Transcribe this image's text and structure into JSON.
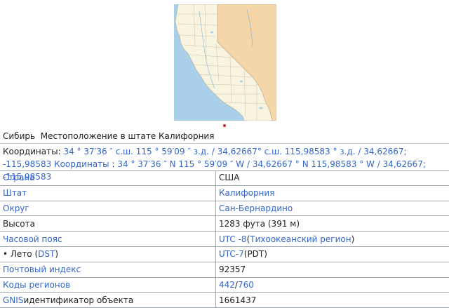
{
  "caption": {
    "name": "Сибирь",
    "text": "Местоположение в штате Калифорния"
  },
  "coordinates": {
    "label": "Координаты:",
    "dms": "34 ° 37′36 ″ с.ш. 115 ° 59′09 ″ з.д.",
    "sep1": " / ",
    "decimal": "34,62667° с.ш. 115,98583 ° з.д.",
    "sep2": " / ",
    "signed": "34,62667; -115,98583",
    "label2": "Координаты",
    "colon": " : ",
    "dms2": "34 ° 37′36 ″ N 115 ° 59′09 ″ W",
    "sep3": " / ",
    "decimal2": "34,62667 ° N 115,98583 ° W",
    "sep4": " / ",
    "signed2": "34,62667; -115,98583"
  },
  "rows": {
    "country": {
      "label": "Страна",
      "value": "США"
    },
    "state": {
      "label": "Штат",
      "value": "Калифорния"
    },
    "county": {
      "label": "Округ",
      "value": "Сан-Бернардино"
    },
    "elevation": {
      "label": "Высота",
      "value": "1283 фута (391 м)"
    },
    "timezone": {
      "label": "Часовой пояс",
      "utc": "UTC -8",
      "open": " (",
      "region": "Тихоокеанский регион",
      "close": " )"
    },
    "summer": {
      "bullet": "• Лето (",
      "dst": "DST",
      "close": " )",
      "utc": "UTC-7",
      "paren": " (PDT)"
    },
    "zip": {
      "label": "Почтовый индекс",
      "value": "92357"
    },
    "area": {
      "label": "Коды регионов",
      "code1": "442",
      "slash": " / ",
      "code2": "760"
    },
    "gnis": {
      "link": "GNIS",
      "label": " идентификатор объекта",
      "value": "1661437"
    }
  },
  "colors": {
    "link": "#3366cc",
    "map_land": "#f8f4df",
    "map_nevada": "#f4d6a8",
    "map_ocean": "#a9cfea",
    "marker": "#cc2222"
  }
}
